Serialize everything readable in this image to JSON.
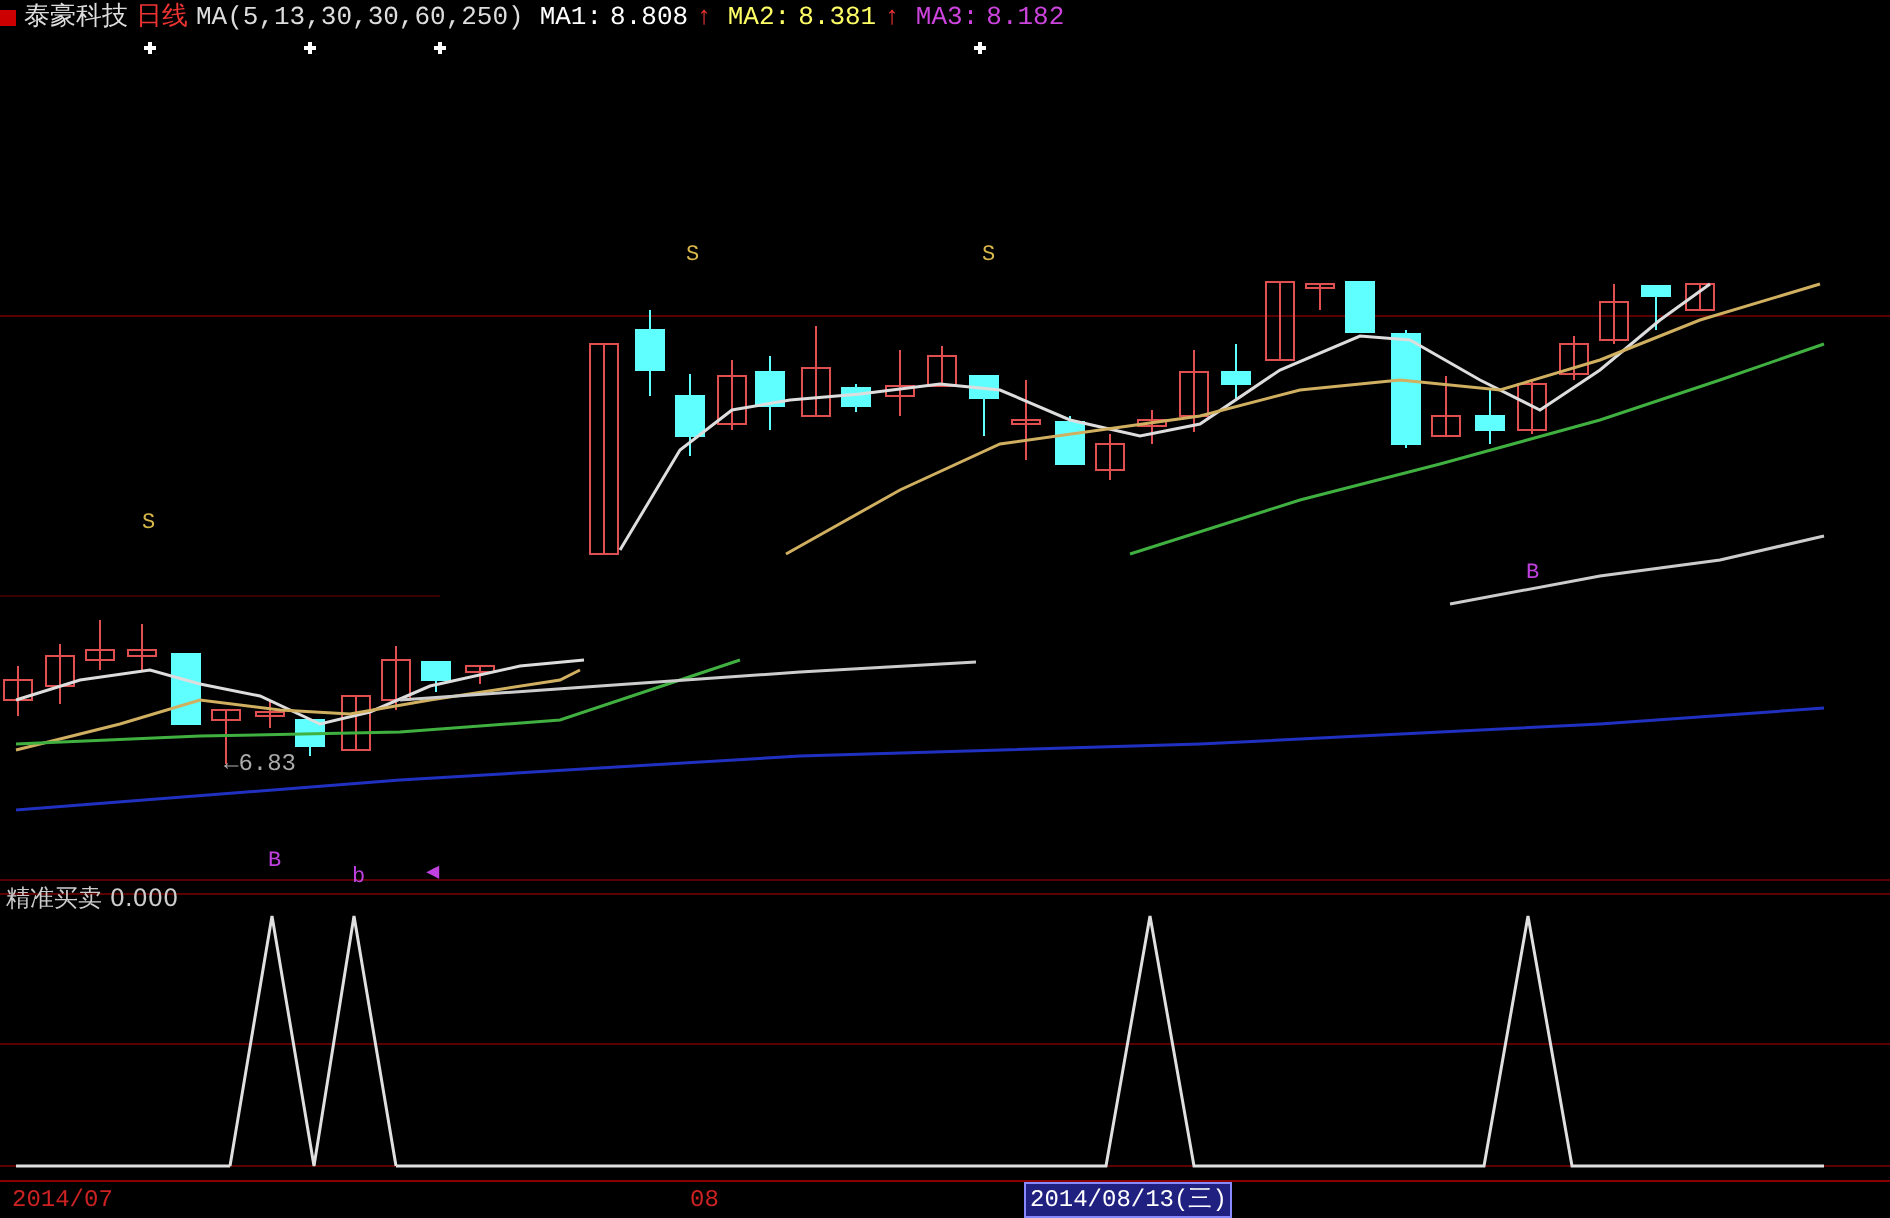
{
  "header": {
    "stock_name": "泰豪科技",
    "period": "日线",
    "ma_formula": "MA(5,13,30,30,60,250)",
    "ma_values": [
      {
        "label": "MA1:",
        "value": "8.808",
        "arrow": "↑",
        "color": "#ffffff"
      },
      {
        "label": "MA2:",
        "value": "8.381",
        "arrow": "↑",
        "color": "#ffff66"
      },
      {
        "label": "MA3:",
        "value": "8.182",
        "color": "#cc44dd"
      }
    ]
  },
  "main_chart": {
    "signals": [
      {
        "text": "S",
        "kind": "sell"
      },
      {
        "text": "S",
        "kind": "sell"
      },
      {
        "text": "S",
        "kind": "sell"
      },
      {
        "text": "B",
        "kind": "buy"
      },
      {
        "text": "b",
        "kind": "buy"
      },
      {
        "text": "◀",
        "kind": "buy"
      },
      {
        "text": "B",
        "kind": "buy"
      }
    ],
    "low_label": "←6.83"
  },
  "indicator": {
    "name": "精准买卖",
    "value": "0.000"
  },
  "date_axis": [
    {
      "text": "2014/07",
      "selected": false
    },
    {
      "text": "08",
      "selected": false
    },
    {
      "text": "2014/08/13(三)",
      "selected": true
    }
  ]
}
